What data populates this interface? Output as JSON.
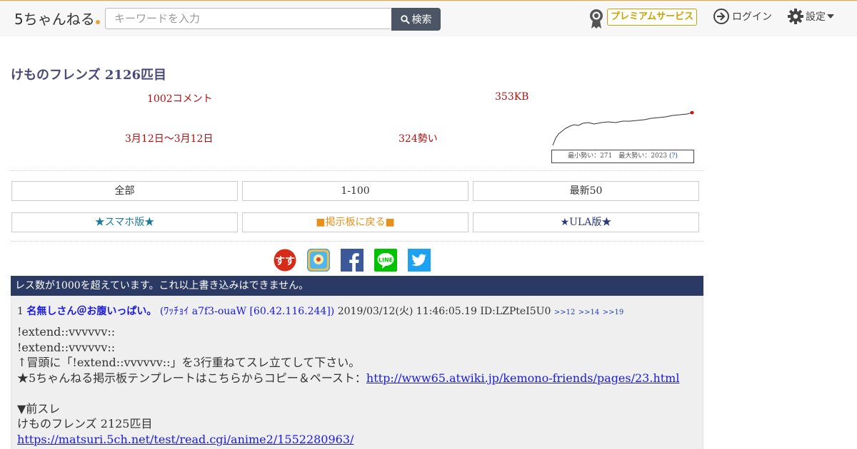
{
  "header": {
    "logo_text": "5ちゃんねる",
    "search_placeholder": "キーワードを入力",
    "search_button": "検索",
    "premium_label": "プレミアムサービス",
    "login_label": "ログイン",
    "settings_label": "設定"
  },
  "thread": {
    "title": "けものフレンズ 2126匹目",
    "comments": "1002コメント",
    "size": "353KB",
    "period": "3月12日〜3月12日",
    "momentum": "324勢い",
    "chart_caption": "最小勢い：271　最大勢い：2023",
    "chart_help": "(?)"
  },
  "nav": {
    "all": "全部",
    "range": "1-100",
    "latest": "最新50",
    "smartphone": "★スマホ版★",
    "back_to_board": "■掲示板に戻る■",
    "ula": "★ULA版★"
  },
  "banner_text": "レス数が1000を超えています。これ以上書き込みはできません。",
  "post": {
    "number": "1",
    "name": "名無しさん＠お腹いっぱい。",
    "trip": "(ﾜｯﾁｮｲ a7f3-ouaW [60.42.116.244])",
    "date": "2019/03/12(火) 11:46:05.19",
    "id": "ID:LZPteI5U0",
    "anchors": [
      ">>12",
      ">>14",
      ">>19"
    ],
    "lines": [
      "!extend::vvvvvv::",
      "!extend::vvvvvv::",
      "↑冒頭に「!extend::vvvvvv::」を3行重ねてスレ立てして下さい。",
      "★5ちゃんねる掲示板テンプレートはこちらからコピー＆ペースト："
    ],
    "template_link": "http://www65.atwiki.jp/kemono-friends/pages/23.html",
    "prev_label": "▼前スレ",
    "prev_title": "けものフレンズ 2125匹目",
    "prev_link": "https://matsuri.5ch.net/test/read.cgi/anime2/1552280963/"
  },
  "colors": {
    "accent": "#e8a33d",
    "banner": "#2b3a64",
    "meta": "#b01010",
    "link": "#1a1ae0",
    "premium": "#c9a400"
  },
  "icons": [
    "search-icon",
    "premium-medal-icon",
    "login-icon",
    "gear-icon",
    "caret-down-icon",
    "sukusu-share-icon",
    "hatena-share-icon",
    "facebook-icon",
    "line-icon",
    "twitter-icon"
  ]
}
